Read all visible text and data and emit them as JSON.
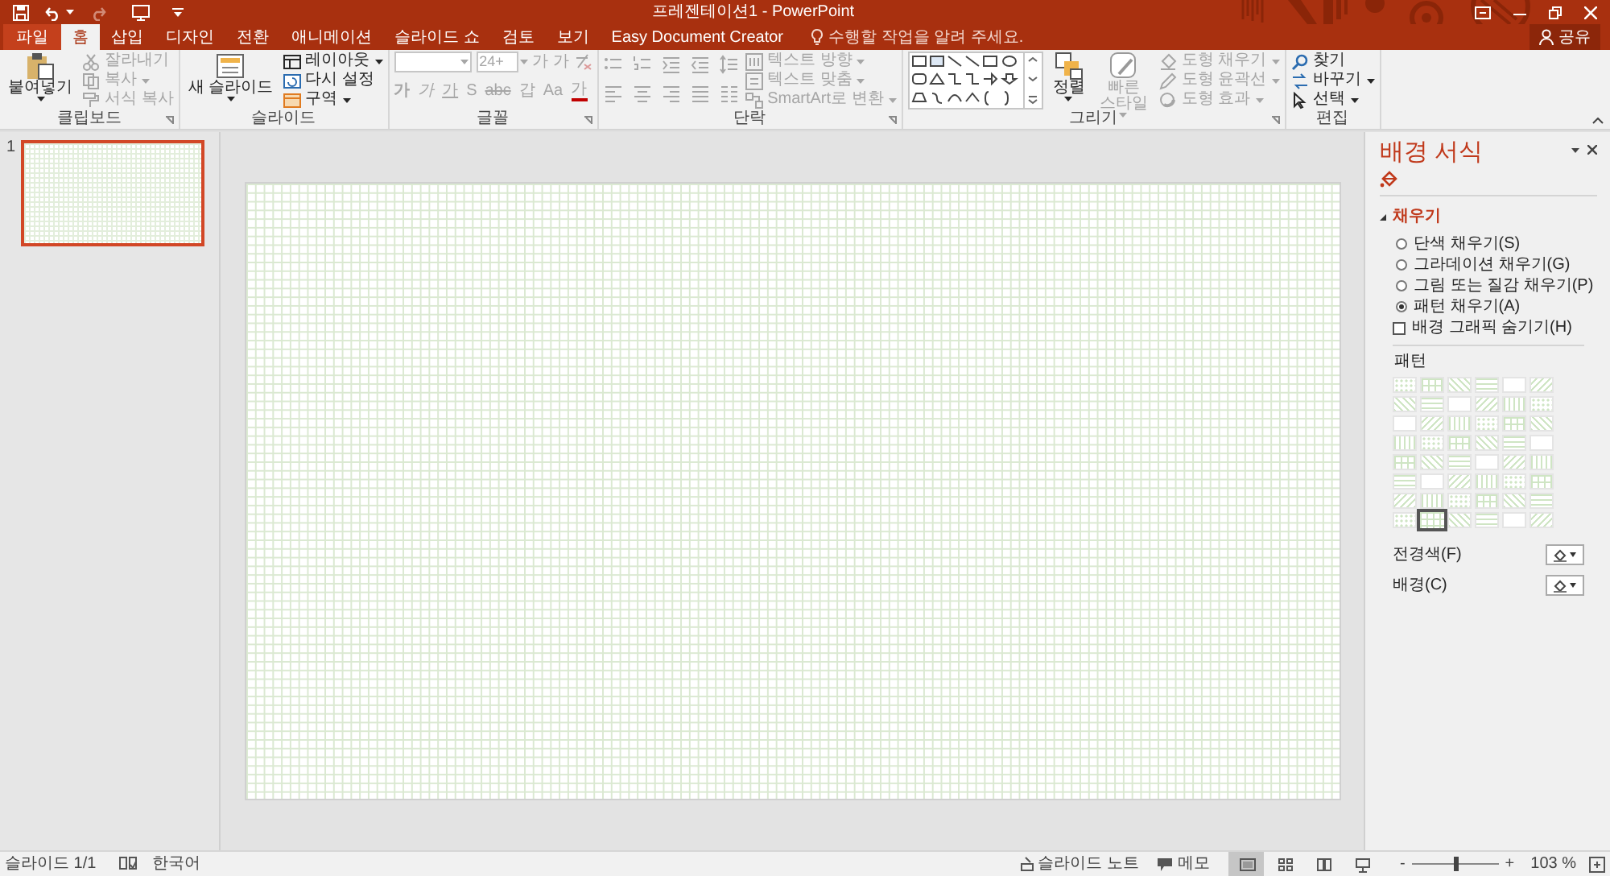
{
  "window": {
    "title": "프레젠테이션1 - PowerPoint"
  },
  "tabs": [
    {
      "label": "파일",
      "kind": "file",
      "selected": false
    },
    {
      "label": "홈",
      "kind": "tab",
      "selected": true
    },
    {
      "label": "삽입",
      "kind": "tab",
      "selected": false
    },
    {
      "label": "디자인",
      "kind": "tab",
      "selected": false
    },
    {
      "label": "전환",
      "kind": "tab",
      "selected": false
    },
    {
      "label": "애니메이션",
      "kind": "tab",
      "selected": false
    },
    {
      "label": "슬라이드 쇼",
      "kind": "tab",
      "selected": false
    },
    {
      "label": "검토",
      "kind": "tab",
      "selected": false
    },
    {
      "label": "보기",
      "kind": "tab",
      "selected": false
    },
    {
      "label": "Easy Document Creator",
      "kind": "tab",
      "selected": false
    }
  ],
  "tell_me": {
    "placeholder": "수행할 작업을 알려 주세요."
  },
  "share": {
    "label": "공유"
  },
  "ribbon": {
    "groups": [
      {
        "label": "클립보드",
        "launcher": true,
        "sections": [
          {
            "kind": "large",
            "items": [
              {
                "label": "붙여넣기",
                "disabled": false,
                "dropdown": true
              }
            ]
          },
          {
            "kind": "stack",
            "items": [
              {
                "label": "잘라내기",
                "disabled": true,
                "dropdown": false
              },
              {
                "label": "복사",
                "disabled": true,
                "dropdown": true
              },
              {
                "label": "서식 복사",
                "disabled": true,
                "dropdown": false
              }
            ]
          }
        ]
      },
      {
        "label": "슬라이드",
        "launcher": false,
        "sections": [
          {
            "kind": "large",
            "items": [
              {
                "label": "새 슬라이드",
                "disabled": false,
                "dropdown": true
              }
            ]
          },
          {
            "kind": "stack",
            "items": [
              {
                "label": "레이아웃",
                "disabled": false,
                "dropdown": true
              },
              {
                "label": "다시 설정",
                "disabled": false,
                "dropdown": false
              },
              {
                "label": "구역",
                "disabled": false,
                "dropdown": true
              }
            ]
          }
        ]
      },
      {
        "label": "글꼴",
        "launcher": true,
        "sections": [
          {
            "kind": "font",
            "disabled": true,
            "size_placeholder": "24+",
            "grow": [
              "가",
              "가"
            ],
            "format": [
              "가",
              "가",
              "가",
              "S",
              "abc",
              "갑",
              "Aa",
              "가"
            ]
          }
        ]
      },
      {
        "label": "단락",
        "launcher": true,
        "sections": [
          {
            "kind": "paragraph",
            "disabled": true
          },
          {
            "kind": "stack",
            "items": [
              {
                "label": "텍스트 방향",
                "disabled": true,
                "dropdown": true
              },
              {
                "label": "텍스트 맞춤",
                "disabled": true,
                "dropdown": true
              },
              {
                "label": "SmartArt로 변환",
                "disabled": true,
                "dropdown": true
              }
            ]
          }
        ]
      },
      {
        "label": "그리기",
        "launcher": true,
        "sections": [
          {
            "kind": "gallery"
          },
          {
            "kind": "large",
            "items": [
              {
                "label": "정렬",
                "disabled": false,
                "dropdown": true
              },
              {
                "label": "빠른 스타일",
                "disabled": true,
                "dropdown": true
              }
            ]
          },
          {
            "kind": "stack",
            "items": [
              {
                "label": "도형 채우기",
                "disabled": true,
                "dropdown": true
              },
              {
                "label": "도형 윤곽선",
                "disabled": true,
                "dropdown": true
              },
              {
                "label": "도형 효과",
                "disabled": true,
                "dropdown": true
              }
            ]
          }
        ]
      },
      {
        "label": "편집",
        "launcher": false,
        "sections": [
          {
            "kind": "stack",
            "items": [
              {
                "label": "찾기",
                "disabled": false,
                "dropdown": false
              },
              {
                "label": "바꾸기",
                "disabled": false,
                "dropdown": true
              },
              {
                "label": "선택",
                "disabled": false,
                "dropdown": true
              }
            ]
          }
        ]
      }
    ]
  },
  "slides": [
    {
      "number": "1",
      "selected": true
    }
  ],
  "format_pane": {
    "title": "배경 서식",
    "section": {
      "label": "채우기",
      "expanded": true
    },
    "fill_options": [
      {
        "label": "단색 채우기(S)",
        "selected": false
      },
      {
        "label": "그라데이션 채우기(G)",
        "selected": false
      },
      {
        "label": "그림 또는 질감 채우기(P)",
        "selected": false
      },
      {
        "label": "패턴 채우기(A)",
        "selected": true
      }
    ],
    "hide_graphics": {
      "label": "배경 그래픽 숨기기(H)",
      "checked": false
    },
    "pattern_label": "패턴",
    "patterns": [
      {
        "selected": false
      },
      {
        "selected": false
      },
      {
        "selected": false
      },
      {
        "selected": false
      },
      {
        "selected": false
      },
      {
        "selected": false
      },
      {
        "selected": false
      },
      {
        "selected": false
      },
      {
        "selected": false
      },
      {
        "selected": false
      },
      {
        "selected": false
      },
      {
        "selected": false
      },
      {
        "selected": false
      },
      {
        "selected": false
      },
      {
        "selected": false
      },
      {
        "selected": false
      },
      {
        "selected": false
      },
      {
        "selected": false
      },
      {
        "selected": false
      },
      {
        "selected": false
      },
      {
        "selected": false
      },
      {
        "selected": false
      },
      {
        "selected": false
      },
      {
        "selected": false
      },
      {
        "selected": false
      },
      {
        "selected": false
      },
      {
        "selected": false
      },
      {
        "selected": false
      },
      {
        "selected": false
      },
      {
        "selected": false
      },
      {
        "selected": false
      },
      {
        "selected": false
      },
      {
        "selected": false
      },
      {
        "selected": false
      },
      {
        "selected": false
      },
      {
        "selected": false
      },
      {
        "selected": false
      },
      {
        "selected": false
      },
      {
        "selected": false
      },
      {
        "selected": false
      },
      {
        "selected": false
      },
      {
        "selected": false
      },
      {
        "selected": false
      },
      {
        "selected": true
      },
      {
        "selected": false
      },
      {
        "selected": false
      },
      {
        "selected": false
      },
      {
        "selected": false
      }
    ],
    "foreground": {
      "label": "전경색(F)"
    },
    "background": {
      "label": "배경(C)"
    }
  },
  "status_bar": {
    "slide_info": "슬라이드 1/1",
    "language": "한국어",
    "notes": "슬라이드 노트",
    "comments": "메모",
    "views": [
      {
        "selected": true
      },
      {
        "selected": false
      },
      {
        "selected": false
      },
      {
        "selected": false
      }
    ],
    "zoom": {
      "minus": "-",
      "plus": "+",
      "level": 0.5,
      "reading": "103 %"
    }
  }
}
